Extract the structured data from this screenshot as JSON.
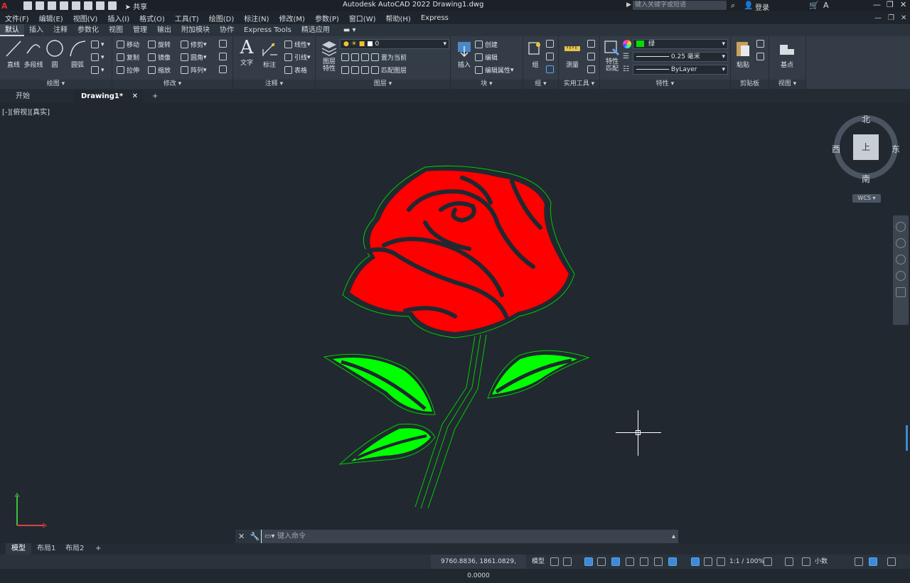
{
  "app": {
    "window_title": "Autodesk AutoCAD 2022    Drawing1.dwg",
    "search_placeholder": "键入关键字或短语",
    "login_label": "登录",
    "share_label": "共享"
  },
  "menu": [
    "文件(F)",
    "编辑(E)",
    "视图(V)",
    "插入(I)",
    "格式(O)",
    "工具(T)",
    "绘图(D)",
    "标注(N)",
    "修改(M)",
    "参数(P)",
    "窗口(W)",
    "帮助(H)",
    "Express"
  ],
  "ribbon_tabs": [
    {
      "label": "默认",
      "active": true
    },
    {
      "label": "插入"
    },
    {
      "label": "注释"
    },
    {
      "label": "参数化"
    },
    {
      "label": "视图"
    },
    {
      "label": "管理"
    },
    {
      "label": "输出"
    },
    {
      "label": "附加模块"
    },
    {
      "label": "协作"
    },
    {
      "label": "Express Tools"
    },
    {
      "label": "精选应用"
    }
  ],
  "ribbon": {
    "draw": {
      "label": "绘图",
      "line": "直线",
      "polyline": "多段线",
      "circle": "圆",
      "arc": "圆弧"
    },
    "modify": {
      "label": "修改",
      "move": "移动",
      "rotate": "旋转",
      "trim": "修剪",
      "copy": "复制",
      "mirror": "镜像",
      "fillet": "圆角",
      "stretch": "拉伸",
      "scale": "缩放",
      "array": "阵列"
    },
    "annotation": {
      "label": "注释",
      "text": "文字",
      "dimension": "标注",
      "linear": "线性",
      "leader": "引线",
      "table": "表格"
    },
    "layers": {
      "label": "图层",
      "layer_props": "图层\n特性",
      "current_layer": "0",
      "make_current": "置为当前",
      "match_layer": "匹配图层"
    },
    "block": {
      "label": "块",
      "insert": "插入",
      "create": "创建",
      "edit": "编辑",
      "edit_attr": "编辑属性"
    },
    "properties": {
      "label": "特性",
      "match": "特性\n匹配",
      "color": "绿",
      "lineweight": "0.25 毫米",
      "linetype": "ByLayer"
    },
    "groups": {
      "label": "组",
      "group": "组"
    },
    "utilities": {
      "label": "实用工具",
      "measure": "测量"
    },
    "clipboard": {
      "label": "剪贴板",
      "paste": "粘贴"
    },
    "view": {
      "label": "视图",
      "base": "基点"
    }
  },
  "doc_tabs": [
    {
      "label": "开始"
    },
    {
      "label": "Drawing1*",
      "active": true
    }
  ],
  "viewport_label": "[-][俯视][真实]",
  "viewcube": {
    "north": "北",
    "south": "南",
    "east": "东",
    "west": "西",
    "face": "上",
    "wcs": "WCS"
  },
  "command": {
    "placeholder": "键入命令"
  },
  "layout_tabs": [
    {
      "label": "模型",
      "active": true
    },
    {
      "label": "布局1"
    },
    {
      "label": "布局2"
    }
  ],
  "status": {
    "coordinates": "9760.8836, 1861.0829, 0.0000",
    "model": "模型",
    "scale": "1:1 / 100%",
    "units": "小数"
  },
  "colors": {
    "rose_fill": "#ff0000",
    "leaf_fill": "#00ff00",
    "outline": "#00cc00",
    "background": "#212830"
  }
}
